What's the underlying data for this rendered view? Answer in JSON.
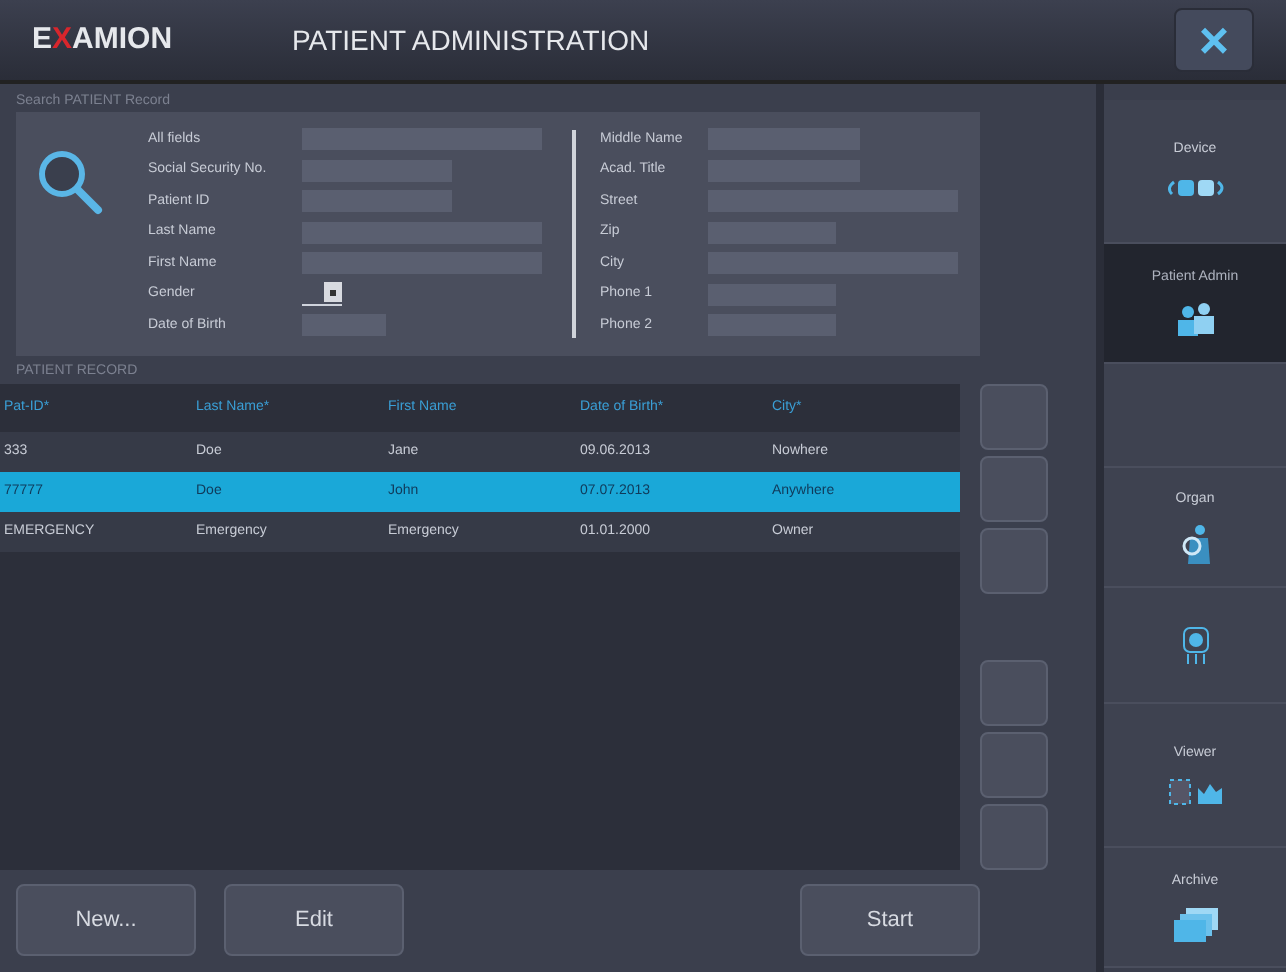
{
  "header": {
    "logo": [
      {
        "text": "E",
        "accent": false
      },
      {
        "text": "X",
        "accent": true
      },
      {
        "text": "AMION",
        "accent": false
      }
    ],
    "title": "PATIENT ADMINISTRATION",
    "close": "×"
  },
  "search": {
    "title": "Search PATIENT Record",
    "left_fields": [
      {
        "label": "All fields",
        "kind": "text"
      },
      {
        "label": "Social Security No.",
        "kind": "text"
      },
      {
        "label": "Patient ID",
        "kind": "text"
      },
      {
        "label": "Last Name",
        "kind": "text"
      },
      {
        "label": "First Name",
        "kind": "text"
      },
      {
        "label": "Gender",
        "kind": "select"
      },
      {
        "label": "Date of Birth",
        "kind": "text"
      }
    ],
    "right_fields": [
      {
        "label": "Middle Name",
        "kind": "text"
      },
      {
        "label": "Acad. Title",
        "kind": "text"
      },
      {
        "label": "Street",
        "kind": "text"
      },
      {
        "label": "Zip",
        "kind": "text"
      },
      {
        "label": "City",
        "kind": "text"
      },
      {
        "label": "Phone 1",
        "kind": "text"
      },
      {
        "label": "Phone 2",
        "kind": "text"
      }
    ]
  },
  "record": {
    "title": "PATIENT RECORD",
    "columns": [
      "Pat-ID*",
      "Last Name*",
      "First Name",
      "Date of Birth*",
      "City*"
    ],
    "rows": [
      {
        "cells": [
          "333",
          "Doe",
          "Jane",
          "09.06.2013",
          "Nowhere"
        ],
        "selected": false
      },
      {
        "cells": [
          "77777",
          "Doe",
          "John",
          "07.07.2013",
          "Anywhere"
        ],
        "selected": true
      },
      {
        "cells": [
          "EMERGENCY",
          "Emergency",
          "Emergency",
          "01.01.2000",
          "Owner"
        ],
        "selected": false
      }
    ]
  },
  "buttons": [
    "New...",
    "Edit",
    "Start"
  ],
  "sidebar": [
    {
      "label": "Device",
      "kind": "device",
      "selected": false
    },
    {
      "label": "Patient Admin",
      "kind": "patients",
      "selected": true
    },
    {
      "kind": "empty",
      "selected": false
    },
    {
      "label": "Organ",
      "kind": "organ",
      "selected": false
    },
    {
      "kind": "radiation",
      "selected": false
    },
    {
      "label": "Viewer",
      "kind": "viewer",
      "selected": false
    },
    {
      "label": "Archive",
      "kind": "archive",
      "selected": false
    }
  ]
}
